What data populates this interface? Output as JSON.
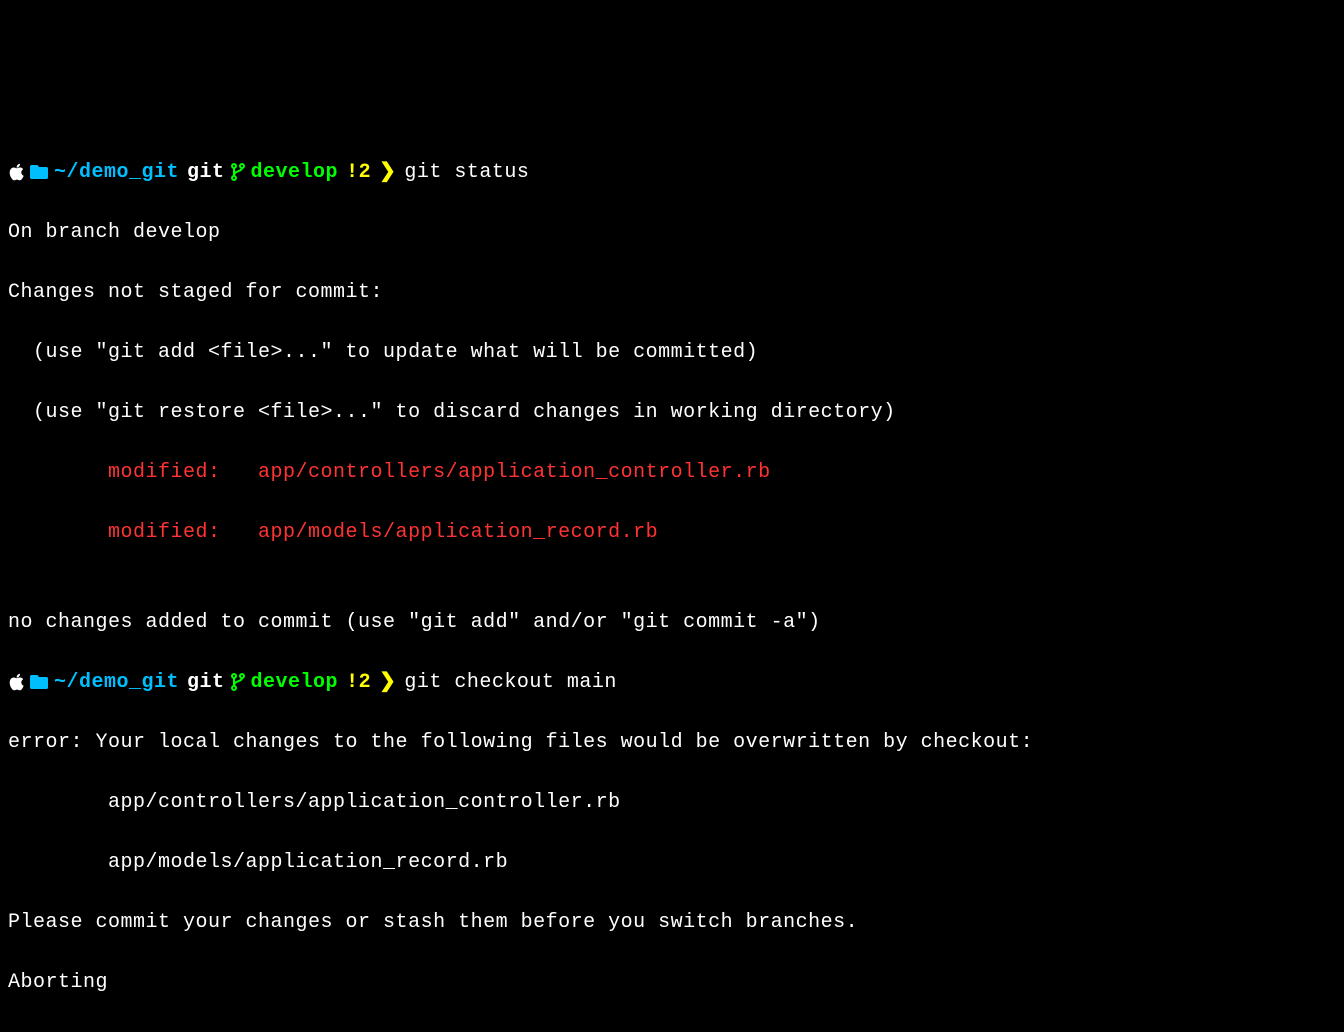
{
  "prompt1": {
    "path_prefix": "~/",
    "path_name": "demo_git",
    "git_label": "git",
    "branch_name": "develop",
    "modified_count": "!2",
    "command": "git status"
  },
  "output1": {
    "line1": "On branch develop",
    "line2": "Changes not staged for commit:",
    "line3": "  (use \"git add <file>...\" to update what will be committed)",
    "line4": "  (use \"git restore <file>...\" to discard changes in working directory)",
    "modified1": "        modified:   app/controllers/application_controller.rb",
    "modified2": "        modified:   app/models/application_record.rb",
    "line5": "",
    "line6": "no changes added to commit (use \"git add\" and/or \"git commit -a\")"
  },
  "prompt2": {
    "path_prefix": "~/",
    "path_name": "demo_git",
    "git_label": "git",
    "branch_name": "develop",
    "modified_count": "!2",
    "command": "git checkout main"
  },
  "output2": {
    "line1": "error: Your local changes to the following files would be overwritten by checkout:",
    "line2": "        app/controllers/application_controller.rb",
    "line3": "        app/models/application_record.rb",
    "line4": "Please commit your changes or stash them before you switch branches.",
    "line5": "Aborting"
  }
}
